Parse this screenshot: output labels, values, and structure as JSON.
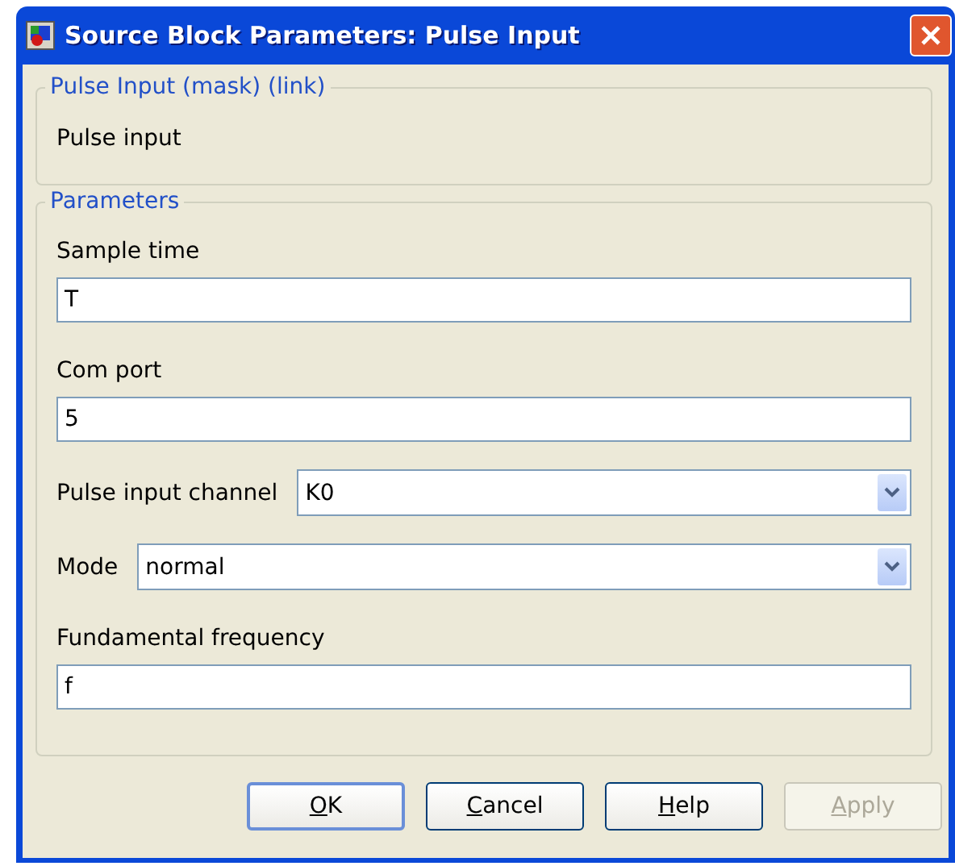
{
  "window": {
    "title": "Source Block Parameters: Pulse Input"
  },
  "description": {
    "legend": "Pulse Input (mask) (link)",
    "text": "Pulse input"
  },
  "parameters": {
    "legend": "Parameters",
    "fields": [
      {
        "kind": "text",
        "label": "Sample time",
        "value": "T"
      },
      {
        "kind": "text",
        "label": "Com port",
        "value": "5"
      },
      {
        "kind": "select",
        "label": "Pulse input channel",
        "value": "K0"
      },
      {
        "kind": "select",
        "label": "Mode",
        "value": "normal"
      },
      {
        "kind": "text",
        "label": "Fundamental frequency",
        "value": "f"
      }
    ]
  },
  "buttons": [
    {
      "label": "OK",
      "disabled": false,
      "default": true
    },
    {
      "label": "Cancel",
      "disabled": false,
      "default": false
    },
    {
      "label": "Help",
      "disabled": false,
      "default": false
    },
    {
      "label": "Apply",
      "disabled": true,
      "default": false
    }
  ]
}
